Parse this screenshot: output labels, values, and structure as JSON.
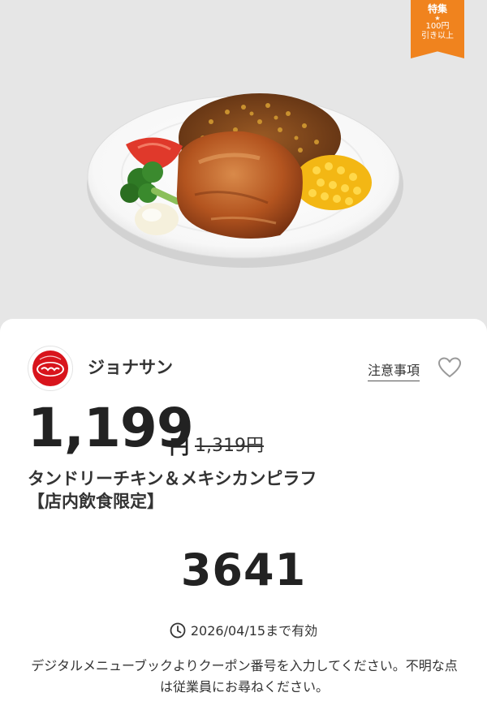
{
  "badge": {
    "line1": "特集",
    "star": "★",
    "line2": "100円",
    "line3": "引き以上"
  },
  "coupon": {
    "brand": "ジョナサン",
    "notes_label": "注意事項",
    "price": "1,199",
    "currency": "円",
    "original_price": "1,319円",
    "title": "タンドリーチキン＆メキシカンピラフ",
    "subtitle": "【店内飲食限定】",
    "code": "3641",
    "validity": "2026/04/15まで有効",
    "instructions": "デジタルメニューブックよりクーポン番号を入力してください。不明な点は従業員にお尋ねください。"
  },
  "icons": {
    "favorite": "heart-icon",
    "clock": "clock-icon",
    "logo": "jonathan-logo"
  },
  "colors": {
    "badge": "#f0831e",
    "logo_red": "#d8141c",
    "background": "#e6e6e6"
  }
}
